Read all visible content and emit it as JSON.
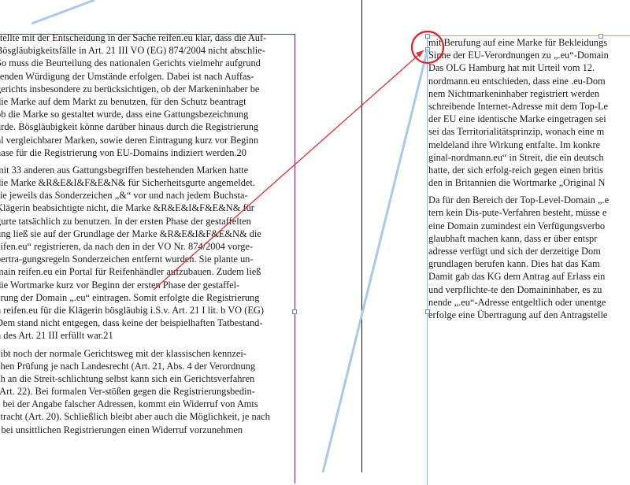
{
  "left_column": {
    "lines": [
      "stellte mit der Entscheidung in der Sache reifen.eu klar, dass die Auf-",
      "Bösgläubigkeitsfälle in Art. 21 III VO (EG) 874/2004 nicht abschlie-",
      "So muss die Beurteilung des nationalen Gerichts vielmehr aufgrund",
      "senden Würdigung der Umstände erfolgen. Dabei ist nach Auffas-",
      "gerichts insbesondere zu berücksichtigen, ob der Markeninhaber be",
      "die Marke auf dem Markt zu benutzen, für den Schutz beantragt",
      "ob die Marke so gestaltet wurde, dass eine Gattungsbezeichnung",
      "urde. Bösgläubigkeit könne darüber hinaus durch die Registrierung",
      "hl vergleichbarer Marken, sowie deren Eintragung kurz vor Beginn",
      "hase für die Registrierung von EU-Domains indiziert werden.20",
      "",
      "mit 33 anderen aus Gattungsbegriffen bestehenden Marken hatte",
      "die Marke &R&E&I&F&E&N& für Sicherheitsgurte angemeldet.",
      "sie jeweils das Sonderzeichen „&“ vor und nach jedem Buchsta-",
      "Klägerin beabsichtigte nicht, die Marke &R&E&I&F&E&N& für",
      "gurte tatsächlich zu benutzen. In der ersten Phase der gestaffelten",
      "ung ließ sie auf der Grundlage der Marke &R&E&I&F&E&N& die",
      "eifen.eu“ registrieren, da nach den in der VO Nr. 874/2004 vorge-",
      "bertra-gungsregeln Sonderzeichen entfernt wurden. Sie plante un-",
      "main reifen.eu ein Portal für Reifenhändler aufzubauen. Zudem ließ",
      "die Wortmarke kurz vor Beginn der ersten Phase der gestaffel-",
      "erung der Domain „.eu“ eintragen. Somit erfolgte die Registrierung",
      "n reifen.eu für die Klägerin bösgläubig i.S.v. Art. 21 I lit. b VO (EG)",
      "Dem stand nicht entgegen, dass keine der beispielhaften Tatbestand-",
      "n des Art. 21 III erfüllt war.21",
      "",
      "eibt noch der normale Gerichtsweg mit der klassischen kennzei-",
      "chen Prüfung je nach Landesrecht (Art. 21, Abs. 4 der Verordnung",
      "ch an die Streit-schlichtung selbst kann sich ein Gerichtsverfahren",
      "(Art. 22). Bei formalen Ver-stößen gegen die Registrierungsbedin-",
      "a bei der Angabe falscher Adressen, kommt ein Widerruf von Amts",
      "etracht (Art. 20). Schließlich bleibt aber auch die Möglichkeit, je nach",
      "t bei unsittlichen Registrierungen einen Widerruf vorzunehmen"
    ]
  },
  "right_column": {
    "lines": [
      "mit Berufung auf eine Marke für Bekleidungs",
      "Sinne der EU-Verordnungen zu „.eu“-Domain",
      "Das OLG Hamburg hat mit Urteil vom 12.",
      "nordmann.eu entschieden, dass eine .eu-Dom",
      "nem Nichtmarkeninhaber registriert werden",
      "schreibende Internet-Adresse mit dem Top-Le",
      "der EU eine identische Marke eingetragen sei",
      "sei das Territorialitätsprinzip, wonach eine m",
      "meldeland ihre Wirkung entfalte. Im konkre",
      "ginal-nordmann.eu“ in Streit, die ein deutsch",
      "hatte, der sich erfolg-reich gegen einen britis",
      "den in Britannien die Wortmarke „Original N",
      "",
      "Da für den Bereich der Top-Level-Domain „.e",
      "tern kein Dis-pute-Verfahren besteht, müsse e",
      "eine Domain zumindest ein Verfügungsverbo",
      "glaubhaft machen kann, dass er über entspr",
      "adresse verfügt und sich der derzeitige Dom",
      "grundlagen berufen kann. Dies hat das Kam",
      "Damit gab das KG dem Antrag auf Erlass ein",
      "und verpflichte-te den Domaininhaber, es zu",
      "nende „.eu“-Adresse entgeltlich oder unentge",
      "erfolge eine Übertragung auf den Antragstelle"
    ]
  },
  "colors": {
    "frame_left": "#b000b0",
    "frame_right": "#7fb0e0",
    "thread_line": "#a9c8ec",
    "link_arrow": "#e03030",
    "highlight_circle": "#e02020",
    "divider": "#111111"
  }
}
